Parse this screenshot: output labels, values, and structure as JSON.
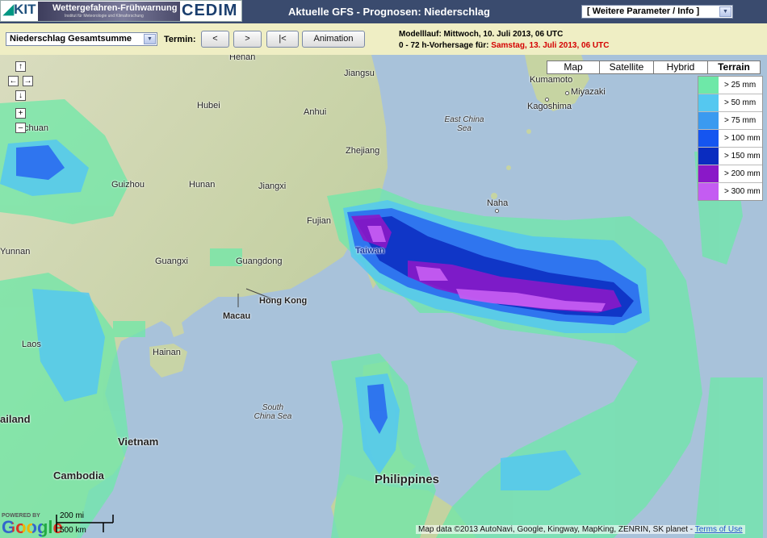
{
  "header": {
    "logo_kit": "KIT",
    "logo_wfw_title": "Wettergefahren-Frühwarnung",
    "logo_wfw_sub": "Institut für Meteorologie und Klimaforschung",
    "logo_cedim": "CEDIM",
    "title": "Aktuelle GFS - Prognosen: Niederschlag",
    "param_select": "[ Weitere Parameter / Info ]"
  },
  "toolbar": {
    "type_select": "Niederschlag Gesamtsumme",
    "termin_label": "Termin:",
    "prev_btn": "<",
    "next_btn": ">",
    "first_btn": "|<",
    "animation_btn": "Animation",
    "model_run": "Modelllauf: Mittwoch, 10. Juli 2013, 06 UTC",
    "forecast_prefix": "0 - 72 h-Vorhersage für:",
    "forecast_date": "Samstag, 13. Juli 2013, 06 UTC"
  },
  "map_type": [
    "Map",
    "Satellite",
    "Hybrid",
    "Terrain"
  ],
  "map_type_active": "Terrain",
  "nav": {
    "up": "↑",
    "left": "←",
    "right": "→",
    "down": "↓",
    "zoom_in": "+",
    "zoom_out": "–"
  },
  "legend": [
    {
      "label": "> 25 mm",
      "color": "#6ee8a8"
    },
    {
      "label": "> 50 mm",
      "color": "#55c8f0"
    },
    {
      "label": "> 75 mm",
      "color": "#3a9af0"
    },
    {
      "label": "> 100 mm",
      "color": "#1555f0"
    },
    {
      "label": "> 150 mm",
      "color": "#0a2cc0"
    },
    {
      "label": "> 200 mm",
      "color": "#8a18c8"
    },
    {
      "label": "> 300 mm",
      "color": "#c45cf2"
    }
  ],
  "labels": {
    "henan": "Henan",
    "jiangsu": "Jiangsu",
    "hubei": "Hubei",
    "anhui": "Anhui",
    "sichuan": "chuan",
    "zhejiang": "Zhejiang",
    "guizhou": "Guizhou",
    "hunan": "Hunan",
    "jiangxi": "Jiangxi",
    "fujian": "Fujian",
    "yunnan": "Yunnan",
    "guangxi": "Guangxi",
    "guangdong": "Guangdong",
    "taiwan": "Taiwan",
    "hongkong": "Hong Kong",
    "macau": "Macau",
    "hainan": "Hainan",
    "laos": "Laos",
    "thailand": "ailand",
    "vietnam": "Vietnam",
    "cambodia": "Cambodia",
    "philippines": "Philippines",
    "south_china_sea": "South China Sea",
    "east_china_sea": "East China Sea",
    "kumamoto": "Kumamoto",
    "miyazaki": "Miyazaki",
    "kagoshima": "Kagoshima",
    "naha": "Naha"
  },
  "footer": {
    "powered_by": "POWERED BY",
    "google": "Google",
    "scale_mi": "200 mi",
    "scale_km": "500 km",
    "attribution": "Map data ©2013 AutoNavi, Google, Kingway, MapKing, ZENRIN, SK planet -",
    "terms": "Terms of Use"
  }
}
